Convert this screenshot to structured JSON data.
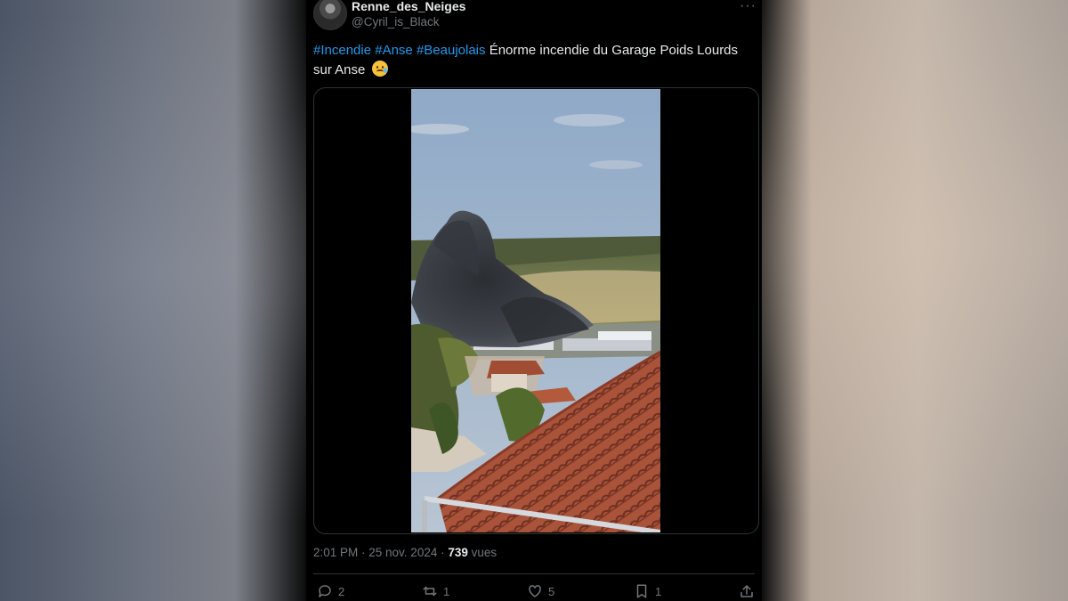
{
  "tweet": {
    "display_name": "Renne_des_Neiges",
    "handle": "@Cyril_is_Black",
    "more_label": "···",
    "hashtags": [
      "#Incendie",
      "#Anse",
      "#Beaujolais"
    ],
    "text_main": "Énorme incendie du Garage Poids Lourds sur Anse",
    "emoji_name": "sad-tear-face-icon",
    "media_alt": "video-thumbnail-fire-smoke",
    "timestamp": "2:01 PM · 25 nov. 2024 · ",
    "views_count": "739",
    "views_label": "vues"
  },
  "actions": {
    "reply_count": "2",
    "retweet_count": "1",
    "like_count": "5",
    "bookmark_count": "1"
  },
  "colors": {
    "background": "#000000",
    "text": "#e7e9ea",
    "muted": "#71767b",
    "link": "#1d9bf0",
    "border": "#2f3336"
  }
}
